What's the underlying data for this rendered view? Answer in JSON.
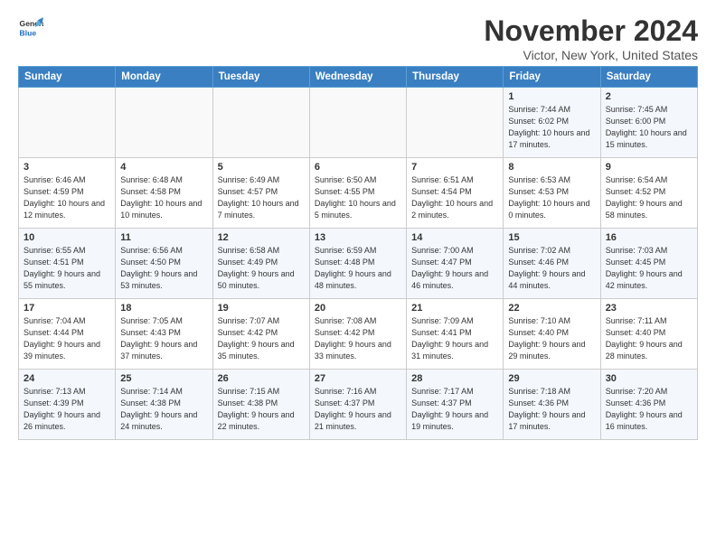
{
  "logo": {
    "line1": "General",
    "line2": "Blue"
  },
  "title": "November 2024",
  "subtitle": "Victor, New York, United States",
  "days_of_week": [
    "Sunday",
    "Monday",
    "Tuesday",
    "Wednesday",
    "Thursday",
    "Friday",
    "Saturday"
  ],
  "weeks": [
    [
      {
        "day": "",
        "info": ""
      },
      {
        "day": "",
        "info": ""
      },
      {
        "day": "",
        "info": ""
      },
      {
        "day": "",
        "info": ""
      },
      {
        "day": "",
        "info": ""
      },
      {
        "day": "1",
        "info": "Sunrise: 7:44 AM\nSunset: 6:02 PM\nDaylight: 10 hours and 17 minutes."
      },
      {
        "day": "2",
        "info": "Sunrise: 7:45 AM\nSunset: 6:00 PM\nDaylight: 10 hours and 15 minutes."
      }
    ],
    [
      {
        "day": "3",
        "info": "Sunrise: 6:46 AM\nSunset: 4:59 PM\nDaylight: 10 hours and 12 minutes."
      },
      {
        "day": "4",
        "info": "Sunrise: 6:48 AM\nSunset: 4:58 PM\nDaylight: 10 hours and 10 minutes."
      },
      {
        "day": "5",
        "info": "Sunrise: 6:49 AM\nSunset: 4:57 PM\nDaylight: 10 hours and 7 minutes."
      },
      {
        "day": "6",
        "info": "Sunrise: 6:50 AM\nSunset: 4:55 PM\nDaylight: 10 hours and 5 minutes."
      },
      {
        "day": "7",
        "info": "Sunrise: 6:51 AM\nSunset: 4:54 PM\nDaylight: 10 hours and 2 minutes."
      },
      {
        "day": "8",
        "info": "Sunrise: 6:53 AM\nSunset: 4:53 PM\nDaylight: 10 hours and 0 minutes."
      },
      {
        "day": "9",
        "info": "Sunrise: 6:54 AM\nSunset: 4:52 PM\nDaylight: 9 hours and 58 minutes."
      }
    ],
    [
      {
        "day": "10",
        "info": "Sunrise: 6:55 AM\nSunset: 4:51 PM\nDaylight: 9 hours and 55 minutes."
      },
      {
        "day": "11",
        "info": "Sunrise: 6:56 AM\nSunset: 4:50 PM\nDaylight: 9 hours and 53 minutes."
      },
      {
        "day": "12",
        "info": "Sunrise: 6:58 AM\nSunset: 4:49 PM\nDaylight: 9 hours and 50 minutes."
      },
      {
        "day": "13",
        "info": "Sunrise: 6:59 AM\nSunset: 4:48 PM\nDaylight: 9 hours and 48 minutes."
      },
      {
        "day": "14",
        "info": "Sunrise: 7:00 AM\nSunset: 4:47 PM\nDaylight: 9 hours and 46 minutes."
      },
      {
        "day": "15",
        "info": "Sunrise: 7:02 AM\nSunset: 4:46 PM\nDaylight: 9 hours and 44 minutes."
      },
      {
        "day": "16",
        "info": "Sunrise: 7:03 AM\nSunset: 4:45 PM\nDaylight: 9 hours and 42 minutes."
      }
    ],
    [
      {
        "day": "17",
        "info": "Sunrise: 7:04 AM\nSunset: 4:44 PM\nDaylight: 9 hours and 39 minutes."
      },
      {
        "day": "18",
        "info": "Sunrise: 7:05 AM\nSunset: 4:43 PM\nDaylight: 9 hours and 37 minutes."
      },
      {
        "day": "19",
        "info": "Sunrise: 7:07 AM\nSunset: 4:42 PM\nDaylight: 9 hours and 35 minutes."
      },
      {
        "day": "20",
        "info": "Sunrise: 7:08 AM\nSunset: 4:42 PM\nDaylight: 9 hours and 33 minutes."
      },
      {
        "day": "21",
        "info": "Sunrise: 7:09 AM\nSunset: 4:41 PM\nDaylight: 9 hours and 31 minutes."
      },
      {
        "day": "22",
        "info": "Sunrise: 7:10 AM\nSunset: 4:40 PM\nDaylight: 9 hours and 29 minutes."
      },
      {
        "day": "23",
        "info": "Sunrise: 7:11 AM\nSunset: 4:40 PM\nDaylight: 9 hours and 28 minutes."
      }
    ],
    [
      {
        "day": "24",
        "info": "Sunrise: 7:13 AM\nSunset: 4:39 PM\nDaylight: 9 hours and 26 minutes."
      },
      {
        "day": "25",
        "info": "Sunrise: 7:14 AM\nSunset: 4:38 PM\nDaylight: 9 hours and 24 minutes."
      },
      {
        "day": "26",
        "info": "Sunrise: 7:15 AM\nSunset: 4:38 PM\nDaylight: 9 hours and 22 minutes."
      },
      {
        "day": "27",
        "info": "Sunrise: 7:16 AM\nSunset: 4:37 PM\nDaylight: 9 hours and 21 minutes."
      },
      {
        "day": "28",
        "info": "Sunrise: 7:17 AM\nSunset: 4:37 PM\nDaylight: 9 hours and 19 minutes."
      },
      {
        "day": "29",
        "info": "Sunrise: 7:18 AM\nSunset: 4:36 PM\nDaylight: 9 hours and 17 minutes."
      },
      {
        "day": "30",
        "info": "Sunrise: 7:20 AM\nSunset: 4:36 PM\nDaylight: 9 hours and 16 minutes."
      }
    ]
  ]
}
